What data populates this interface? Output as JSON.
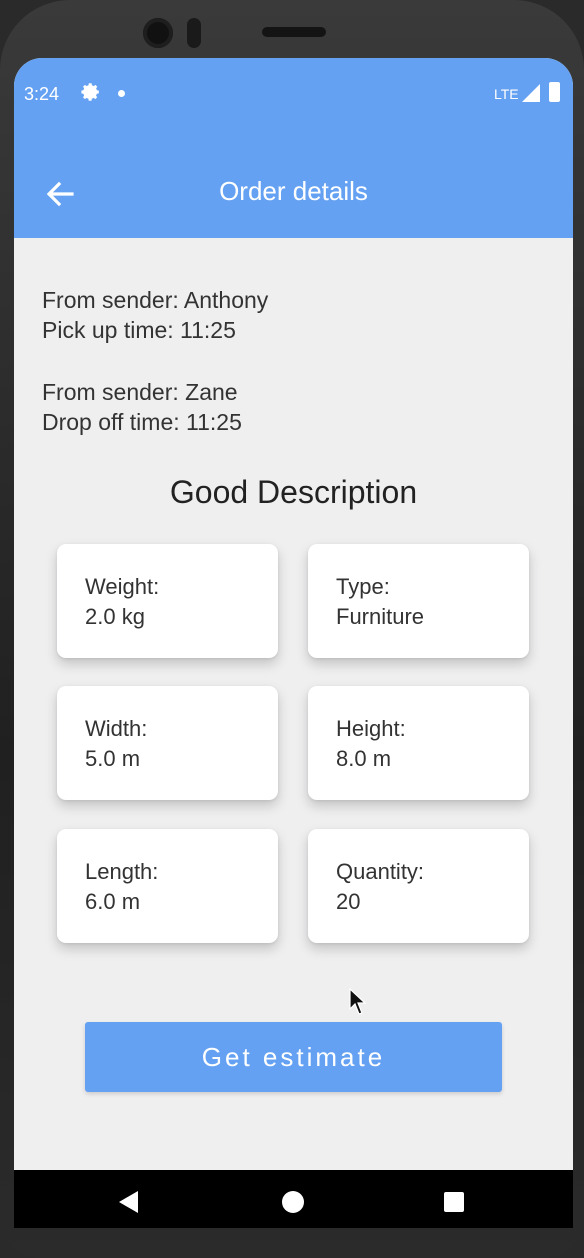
{
  "status_bar": {
    "time": "3:24",
    "network": "LTE",
    "icons": [
      "gear-icon",
      "notification-dot",
      "signal-icon",
      "battery-icon"
    ]
  },
  "app_bar": {
    "title": "Order details",
    "back_icon": "arrow-left-icon",
    "color": "#64a1f2"
  },
  "pickup": {
    "sender_line": "From sender: Anthony",
    "time_line": "Pick up time: 11:25"
  },
  "dropoff": {
    "sender_line": "From sender: Zane",
    "time_line": "Drop off time: 11:25"
  },
  "section_title": "Good Description",
  "cards": [
    {
      "label": "Weight:",
      "value": "2.0 kg"
    },
    {
      "label": "Type:",
      "value": "Furniture"
    },
    {
      "label": "Width:",
      "value": "5.0 m"
    },
    {
      "label": "Height:",
      "value": "8.0 m"
    },
    {
      "label": "Length:",
      "value": "6.0 m"
    },
    {
      "label": "Quantity:",
      "value": "20"
    }
  ],
  "estimate_button": {
    "label": "Get estimate"
  },
  "nav_bar": {
    "icons": [
      "nav-back-icon",
      "nav-home-icon",
      "nav-recents-icon"
    ]
  }
}
